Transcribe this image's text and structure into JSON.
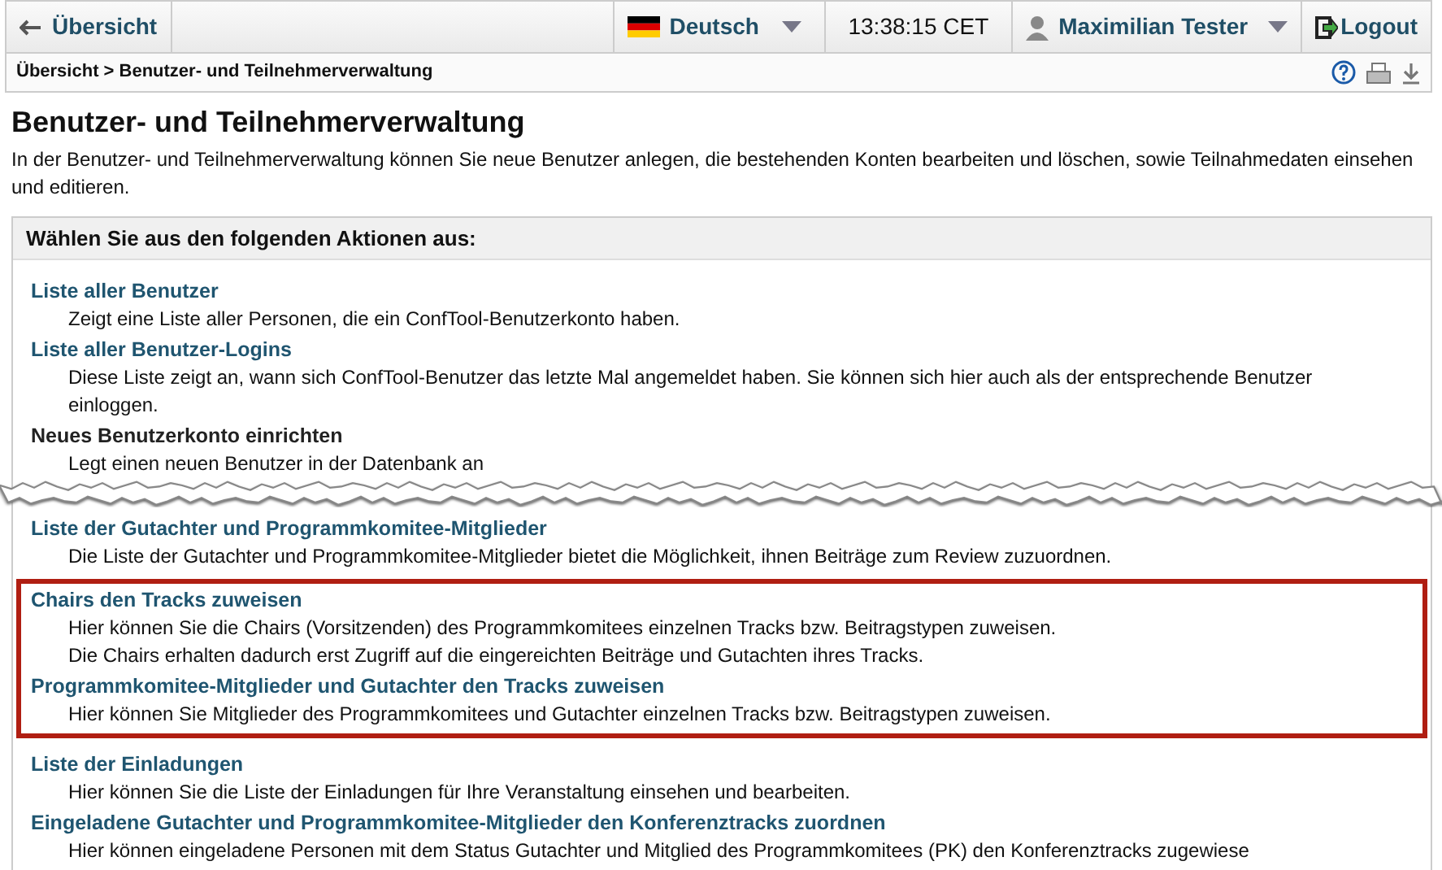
{
  "topbar": {
    "back": "Übersicht",
    "language": "Deutsch",
    "time": "13:38:15 CET",
    "user": "Maximilian Tester",
    "logout": "Logout"
  },
  "breadcrumb": "Übersicht > Benutzer- und Teilnehmerverwaltung",
  "title": "Benutzer- und Teilnehmerverwaltung",
  "intro": "In der Benutzer- und Teilnehmerverwaltung können Sie neue Benutzer anlegen, die bestehenden Konten bearbeiten und löschen, sowie Teilnahmedaten einsehen und editieren.",
  "panel": {
    "heading": "Wählen Sie aus den folgenden Aktionen aus:",
    "sections": [
      {
        "groups": [
          {
            "highlighted": false,
            "items": [
              {
                "kind": "link",
                "title": "Liste aller Benutzer",
                "description": [
                  "Zeigt eine Liste aller Personen, die ein ConfTool-Benutzerkonto haben."
                ]
              },
              {
                "kind": "link",
                "title": "Liste aller Benutzer-Logins",
                "description": [
                  "Diese Liste zeigt an, wann sich ConfTool-Benutzer das letzte Mal angemeldet haben. Sie können sich hier auch als der entsprechende Benutzer",
                  "einloggen."
                ]
              },
              {
                "kind": "plain",
                "title": "Neues Benutzerkonto einrichten",
                "description": [
                  "Legt einen neuen Benutzer in der Datenbank an"
                ]
              }
            ]
          }
        ]
      },
      {
        "groups": [
          {
            "highlighted": false,
            "items": [
              {
                "kind": "link",
                "title": "Liste der Gutachter und Programmkomitee-Mitglieder",
                "description": [
                  "Die Liste der Gutachter und Programmkomitee-Mitglieder bietet die Möglichkeit, ihnen Beiträge zum Review zuzuordnen."
                ]
              }
            ]
          },
          {
            "highlighted": true,
            "items": [
              {
                "kind": "link",
                "title": "Chairs den Tracks zuweisen",
                "description": [
                  "Hier können Sie die Chairs (Vorsitzenden) des Programmkomitees einzelnen Tracks bzw. Beitragstypen zuweisen.",
                  "Die Chairs erhalten dadurch erst Zugriff auf die eingereichten Beiträge und Gutachten ihres Tracks."
                ]
              },
              {
                "kind": "link",
                "title": "Programmkomitee-Mitglieder und Gutachter den Tracks zuweisen",
                "description": [
                  "Hier können Sie Mitglieder des Programmkomitees und Gutachter einzelnen Tracks bzw. Beitragstypen zuweisen."
                ]
              }
            ]
          },
          {
            "highlighted": false,
            "items": [
              {
                "kind": "link",
                "title": "Liste der Einladungen",
                "description": [
                  "Hier können Sie die Liste der Einladungen für Ihre Veranstaltung einsehen und bearbeiten."
                ]
              },
              {
                "kind": "link",
                "title": "Eingeladene Gutachter und Programmkomitee-Mitglieder den Konferenztracks zuordnen",
                "description": [
                  "Hier können eingeladene Personen mit dem Status Gutachter und Mitglied des Programmkomitees (PK) den Konferenztracks zugewiese"
                ]
              }
            ]
          }
        ]
      }
    ]
  }
}
